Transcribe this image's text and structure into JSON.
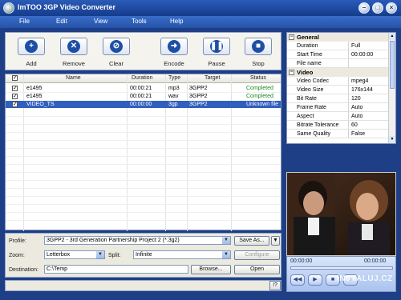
{
  "window": {
    "title": "ImTOO 3GP Video Converter"
  },
  "menu": [
    "File",
    "Edit",
    "View",
    "Tools",
    "Help"
  ],
  "toolbar": {
    "buttons": [
      {
        "label": "Add",
        "icon": "plus-icon"
      },
      {
        "label": "Remove",
        "icon": "x-icon"
      },
      {
        "label": "Clear",
        "icon": "clear-icon"
      },
      {
        "label": "Encode",
        "icon": "encode-arrow-icon"
      },
      {
        "label": "Pause",
        "icon": "pause-icon"
      },
      {
        "label": "Stop",
        "icon": "stop-icon"
      }
    ]
  },
  "file_list": {
    "columns": [
      "Name",
      "Duration",
      "Type",
      "Target",
      "Status"
    ],
    "rows": [
      {
        "name": "e1495",
        "duration": "00:00:21",
        "type": "mp3",
        "target": "3GPP2",
        "status": "Completed",
        "checked": true,
        "selected": false
      },
      {
        "name": "e1495",
        "duration": "00:00:21",
        "type": "wav",
        "target": "3GPP2",
        "status": "Completed",
        "checked": true,
        "selected": false
      },
      {
        "name": "VIDEO_TS",
        "duration": "00:00:00",
        "type": "3gp",
        "target": "3GPP2",
        "status": "Unknown file",
        "checked": true,
        "selected": true
      }
    ]
  },
  "settings": {
    "profile_label": "Profile:",
    "profile_value": "3GPP2 - 3rd Generation Partnership Project 2  (*.3g2)",
    "save_as_label": "Save As...",
    "zoom_label": "Zoom:",
    "zoom_value": "Letterbox",
    "split_label": "Split:",
    "split_value": "Infinite",
    "configure_label": "Configure",
    "destination_label": "Destination:",
    "destination_value": "C:\\Temp",
    "browse_label": "Browse...",
    "open_label": "Open",
    "help_label": "!?"
  },
  "properties": {
    "general_label": "General",
    "general": [
      {
        "name": "Duration",
        "value": "Full"
      },
      {
        "name": "Start Time",
        "value": "00:00:00"
      },
      {
        "name": "File name",
        "value": ""
      }
    ],
    "video_label": "Video",
    "video": [
      {
        "name": "Video Codec",
        "value": "mpeg4"
      },
      {
        "name": "Video Size",
        "value": "176x144"
      },
      {
        "name": "Bit Rate",
        "value": "120"
      },
      {
        "name": "Frame Rate",
        "value": "Auto"
      },
      {
        "name": "Aspect",
        "value": "Auto"
      },
      {
        "name": "Bitrate Tolerance",
        "value": "60"
      },
      {
        "name": "Same Quality",
        "value": "False"
      }
    ]
  },
  "player": {
    "time_current": "00:00:00",
    "time_total": "00:00:00",
    "progress": 0
  },
  "watermark": "INSTALUJ.CZ",
  "colors": {
    "titlebar": "#1f4da0",
    "selection": "#315fbd",
    "completed": "#1f8a1f"
  }
}
